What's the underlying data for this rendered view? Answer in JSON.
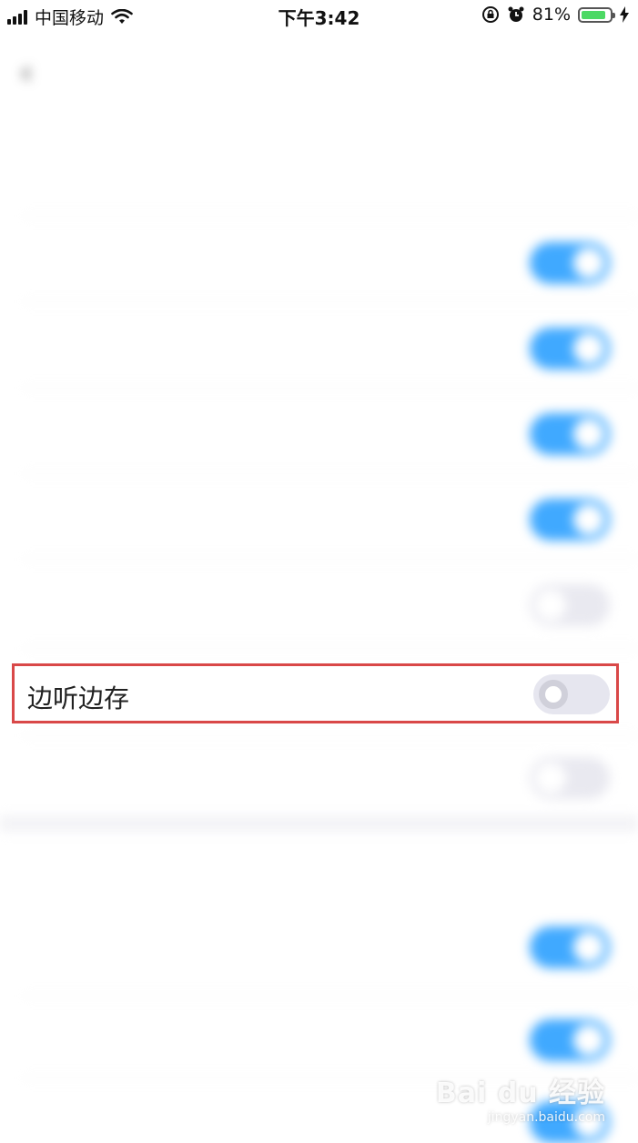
{
  "status_bar": {
    "carrier": "中国移动",
    "time": "下午3:42",
    "battery_percent": "81%",
    "battery_level": 0.81,
    "icons": [
      "signal-icon",
      "wifi-icon",
      "rotation-lock-icon",
      "alarm-icon",
      "battery-icon",
      "charging-icon"
    ]
  },
  "nav": {
    "back_icon": "‹",
    "title": ""
  },
  "section_1": {
    "header": ""
  },
  "rows": [
    {
      "label": "",
      "toggle": null
    },
    {
      "label": "",
      "toggle": true
    },
    {
      "label": "",
      "toggle": true
    },
    {
      "label": "",
      "toggle": true
    },
    {
      "label": "",
      "toggle": true
    },
    {
      "label": "",
      "toggle": false
    }
  ],
  "highlighted_row": {
    "label": "边听边存",
    "toggle": false
  },
  "row_after": {
    "label": "",
    "toggle": false
  },
  "section_2": {
    "header": ""
  },
  "rows_2": [
    {
      "label": "",
      "sub": "",
      "toggle": true
    },
    {
      "label": "",
      "toggle": true
    },
    {
      "label": "",
      "toggle": true
    }
  ],
  "watermark": {
    "logo": "Bai du 经验",
    "url": "jingyan.baidu.com"
  },
  "colors": {
    "toggle_on": "#40a9ff",
    "toggle_off": "#e9e9f0",
    "highlight_border": "#d94848"
  }
}
